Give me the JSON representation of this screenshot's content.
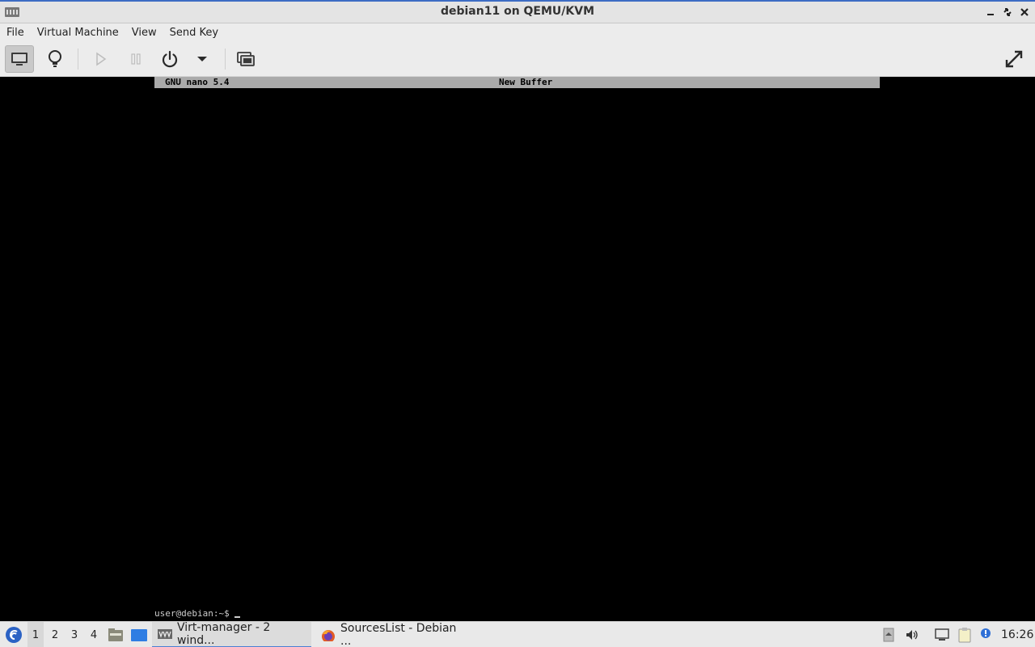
{
  "window": {
    "title": "debian11 on QEMU/KVM",
    "controls": [
      "minimize",
      "maximize",
      "close"
    ]
  },
  "menubar": {
    "items": [
      "File",
      "Virtual Machine",
      "View",
      "Send Key"
    ]
  },
  "toolbar": {
    "buttons": [
      {
        "name": "console-view-button",
        "icon": "monitor-icon",
        "active": true
      },
      {
        "name": "details-view-button",
        "icon": "lightbulb-icon",
        "active": false
      },
      {
        "name": "run-button",
        "icon": "play-icon",
        "enabled": false
      },
      {
        "name": "pause-button",
        "icon": "pause-icon",
        "enabled": false
      },
      {
        "name": "shutdown-button",
        "icon": "power-icon"
      },
      {
        "name": "shutdown-menu-button",
        "icon": "chevron-down-icon"
      },
      {
        "name": "snapshots-button",
        "icon": "snapshot-icon"
      },
      {
        "name": "fullscreen-button",
        "icon": "fullscreen-icon"
      }
    ]
  },
  "vm": {
    "nano_version": "GNU nano 5.4",
    "buffer_name": "New Buffer",
    "prompt": "user@debian:~$"
  },
  "taskbar": {
    "workspaces": [
      "1",
      "2",
      "3",
      "4"
    ],
    "active_workspace": "1",
    "tasks": [
      {
        "label": "Virt-manager - 2 wind...",
        "icon": "virt-manager-icon",
        "active": true
      },
      {
        "label": "SourcesList - Debian ...",
        "icon": "firefox-icon",
        "active": false
      }
    ],
    "clock": "16:26"
  },
  "colors": {
    "title_accent": "#3c6cc4",
    "nano_header_bg": "#aaaaaa",
    "taskbar_active": "#4b7fd3"
  }
}
